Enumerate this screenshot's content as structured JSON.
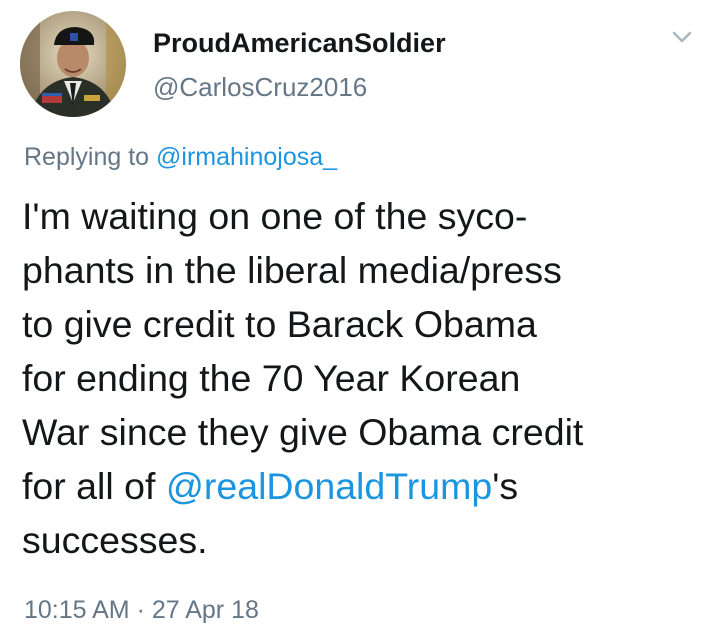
{
  "user": {
    "display_name": "ProudAmericanSoldier",
    "handle": "@CarlosCruz2016"
  },
  "reply": {
    "prefix": "Replying to ",
    "to_handle": "@irmahinojosa_"
  },
  "tweet": {
    "lines": [
      "I'm waiting on one of the syco-",
      "phants in the liberal media/press",
      "to give credit to Barack Obama",
      "for ending the 70 Year Korean",
      "War since they give Obama credit"
    ],
    "line6_prefix": "for all of ",
    "mention": "@realDonaldTrump",
    "line6_suffix": "'s",
    "line7": "successes."
  },
  "meta": {
    "timestamp": "10:15 AM · 27 Apr 18"
  },
  "colors": {
    "link": "#1b95e0",
    "secondary_text": "#657786",
    "primary_text": "#14171a"
  },
  "icons": {
    "menu": "chevron-down-icon",
    "avatar": "avatar"
  }
}
